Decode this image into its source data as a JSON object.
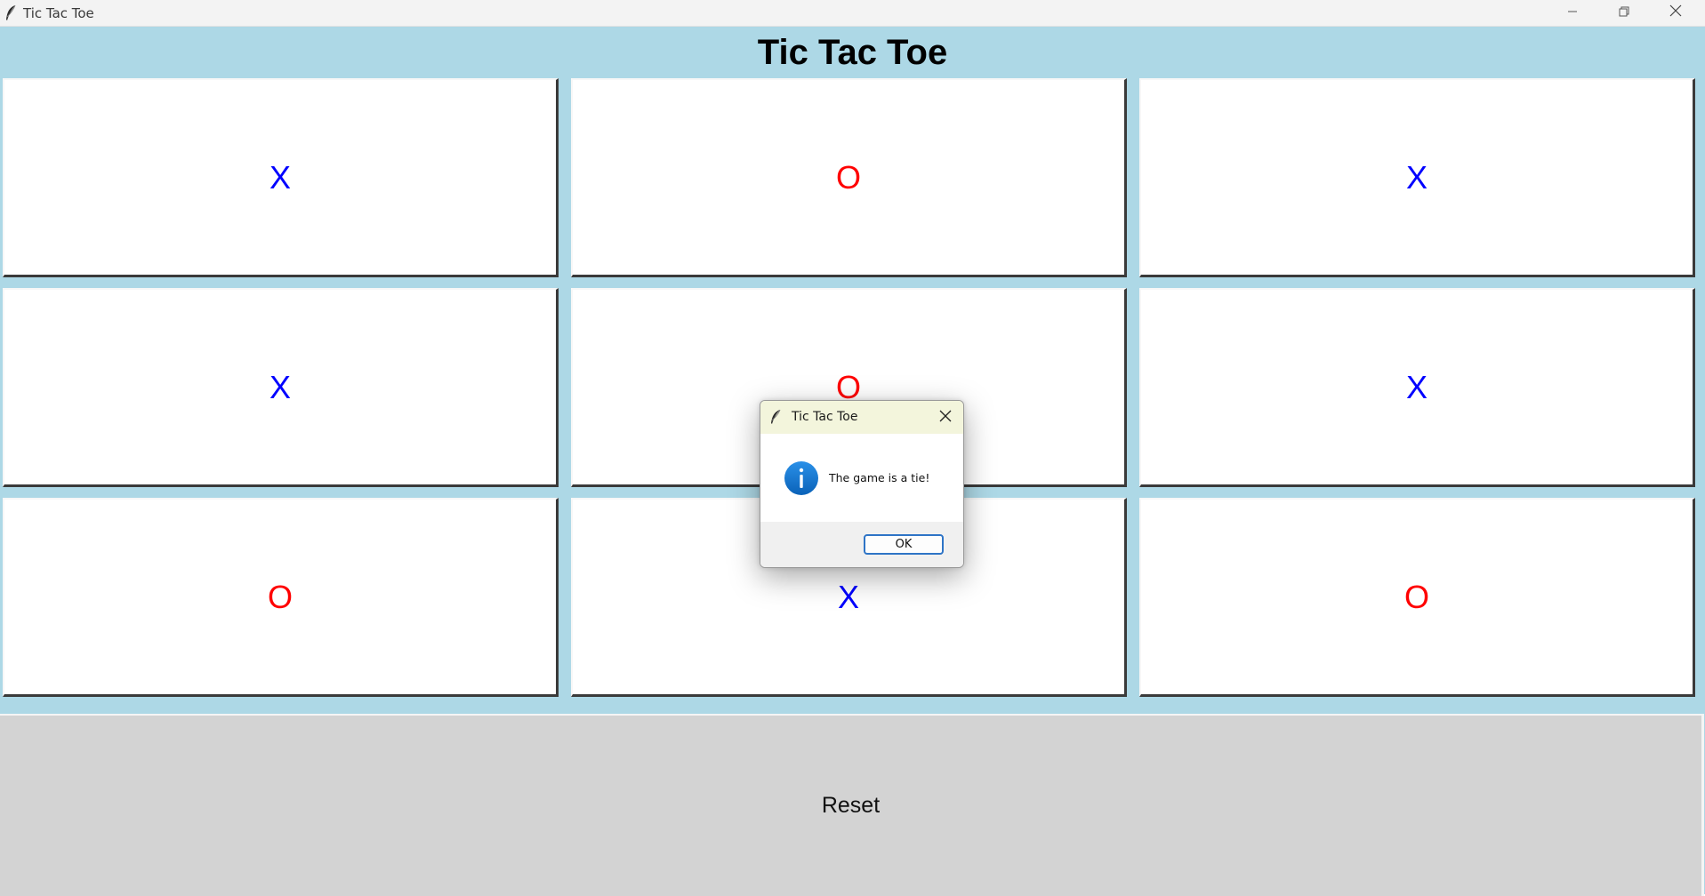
{
  "window": {
    "title": "Tic Tac Toe",
    "controls": [
      "minimize-icon",
      "restore-icon",
      "close-icon"
    ]
  },
  "header": {
    "title": "Tic Tac Toe"
  },
  "board": {
    "cells": [
      {
        "mark": "X",
        "color": "#0000ff"
      },
      {
        "mark": "O",
        "color": "#ff0000"
      },
      {
        "mark": "X",
        "color": "#0000ff"
      },
      {
        "mark": "X",
        "color": "#0000ff"
      },
      {
        "mark": "O",
        "color": "#ff0000"
      },
      {
        "mark": "X",
        "color": "#0000ff"
      },
      {
        "mark": "O",
        "color": "#ff0000"
      },
      {
        "mark": "X",
        "color": "#0000ff"
      },
      {
        "mark": "O",
        "color": "#ff0000"
      }
    ]
  },
  "reset": {
    "label": "Reset"
  },
  "dialog": {
    "title": "Tic Tac Toe",
    "message": "The game is a tie!",
    "icon": "info-icon",
    "ok_label": "OK"
  },
  "colors": {
    "background": "#add8e6",
    "x_color": "#0000ff",
    "o_color": "#ff0000",
    "reset_bg": "#d3d3d3",
    "dialog_title_bg": "#f3f5dc",
    "info_blue": "#1478d4"
  }
}
